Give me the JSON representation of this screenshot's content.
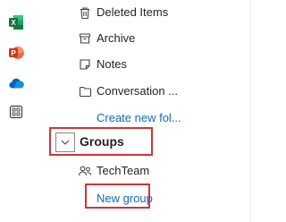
{
  "rail": {
    "apps": [
      {
        "name": "Excel",
        "letter": "X",
        "color": "#1d6f42"
      },
      {
        "name": "PowerPoint",
        "letter": "P",
        "color": "#c43e1c"
      },
      {
        "name": "OneDrive",
        "color": "#0364b8"
      },
      {
        "name": "More apps",
        "color": "#424242"
      }
    ]
  },
  "folders": {
    "deleted_items": "Deleted Items",
    "archive": "Archive",
    "notes": "Notes",
    "conversation": "Conversation ...",
    "create_new_folder": "Create new fol..."
  },
  "groups": {
    "header": "Groups",
    "items": [
      {
        "label": "TechTeam"
      }
    ],
    "new_group": "New group"
  },
  "colors": {
    "link": "#0f6cbd",
    "highlight": "#d13438"
  }
}
